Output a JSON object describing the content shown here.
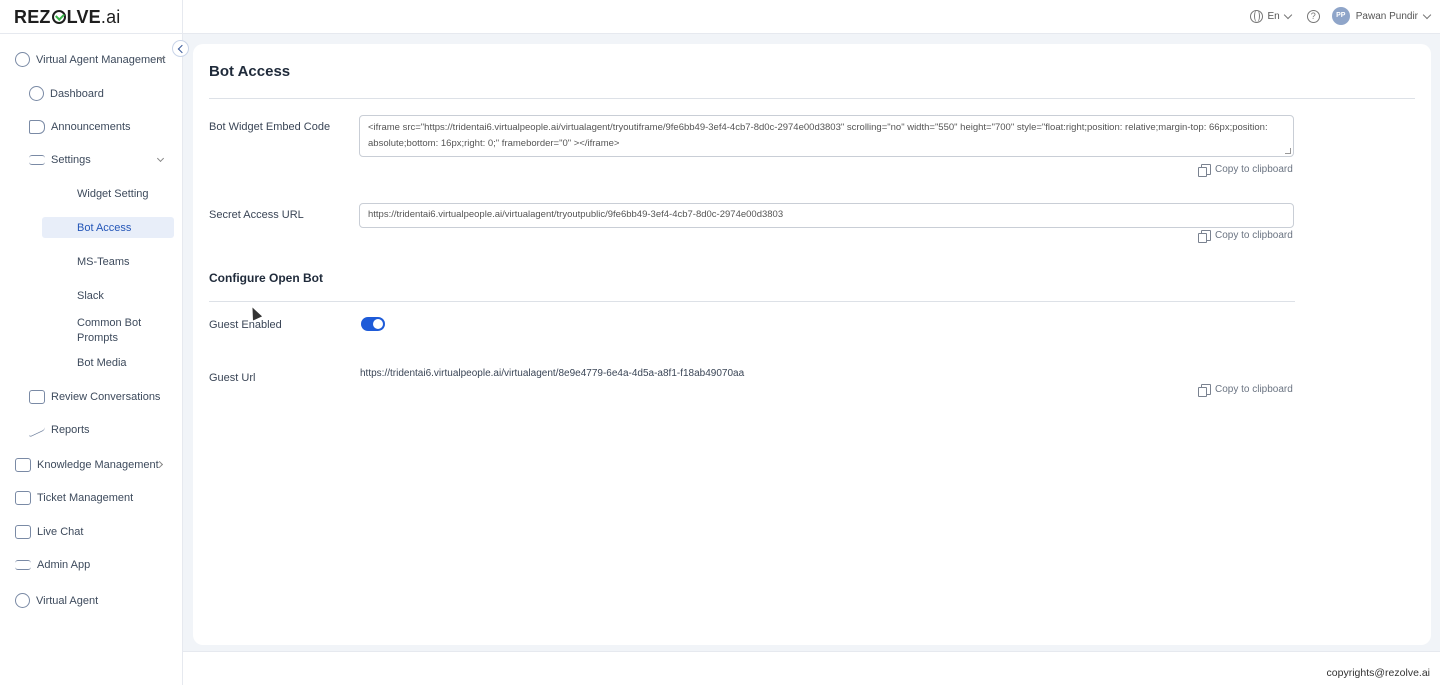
{
  "header": {
    "logo_main": "REZ",
    "logo_rest": "LVE",
    "logo_suffix": ".ai",
    "language": "En",
    "help_symbol": "?",
    "user_initials": "PP",
    "user_name": "Pawan Pundir"
  },
  "sidebar": {
    "group": "Virtual Agent Management",
    "items": [
      {
        "label": "Dashboard",
        "icon": "dashboard-icon"
      },
      {
        "label": "Announcements",
        "icon": "megaphone-icon"
      },
      {
        "label": "Settings",
        "icon": "settings-icon"
      }
    ],
    "settings_sub": [
      {
        "label": "Widget Setting"
      },
      {
        "label": "Bot Access",
        "active": true
      },
      {
        "label": "MS-Teams"
      },
      {
        "label": "Slack"
      },
      {
        "label": "Common Bot Prompts"
      },
      {
        "label": "Bot Media"
      }
    ],
    "after_items": [
      {
        "label": "Review Conversations",
        "icon": "chat-review-icon"
      },
      {
        "label": "Reports",
        "icon": "trend-icon"
      }
    ],
    "top_level": [
      {
        "label": "Knowledge Management",
        "icon": "book-icon"
      },
      {
        "label": "Ticket Management",
        "icon": "ticket-icon"
      },
      {
        "label": "Live Chat",
        "icon": "chat-icon"
      },
      {
        "label": "Admin App",
        "icon": "sliders-icon"
      },
      {
        "label": "Virtual Agent",
        "icon": "headset-icon"
      }
    ]
  },
  "page": {
    "title": "Bot Access",
    "embed_label": "Bot Widget Embed Code",
    "embed_code": "<iframe src=\"https://tridentai6.virtualpeople.ai/virtualagent/tryoutiframe/9fe6bb49-3ef4-4cb7-8d0c-2974e00d3803\" scrolling=\"no\" width=\"550\" height=\"700\" style=\"float:right;position: relative;margin-top: 66px;position: absolute;bottom: 16px;right: 0;\" frameborder=\"0\" ></iframe>",
    "copy_label": "Copy to clipboard",
    "secret_label": "Secret Access URL",
    "secret_url": "https://tridentai6.virtualpeople.ai/virtualagent/tryoutpublic/9fe6bb49-3ef4-4cb7-8d0c-2974e00d3803",
    "configure_title": "Configure Open Bot",
    "guest_enabled_label": "Guest Enabled",
    "guest_enabled": true,
    "guest_url_label": "Guest Url",
    "guest_url": "https://tridentai6.virtualpeople.ai/virtualagent/8e9e4779-6e4a-4d5a-a8f1-f18ab49070aa"
  },
  "footer": {
    "copyright": "copyrights@rezolve.ai"
  },
  "colors": {
    "accent": "#1e5bd8",
    "active_bg": "#e8eef9",
    "main_bg": "#f1f4f8"
  }
}
